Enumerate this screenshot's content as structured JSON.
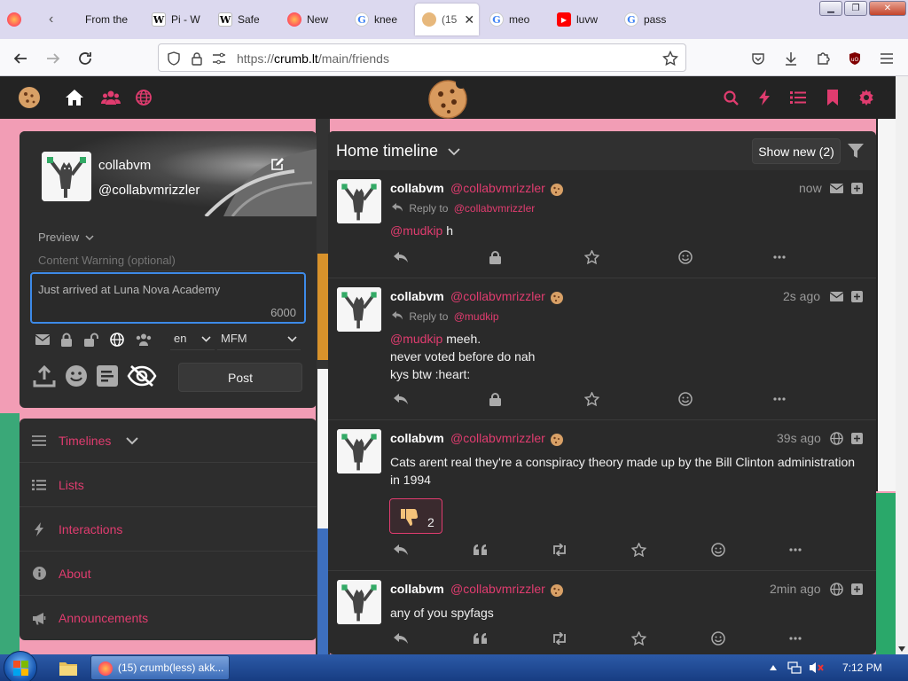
{
  "browser": {
    "tabs": [
      {
        "label": "",
        "icon": "firefox-icon"
      },
      {
        "label": "From the",
        "icon": "page-icon"
      },
      {
        "label": "Pi - W",
        "icon": "wikipedia-icon"
      },
      {
        "label": "Safe",
        "icon": "wikipedia-icon"
      },
      {
        "label": "New",
        "icon": "firefox-icon"
      },
      {
        "label": "knee",
        "icon": "google-icon"
      },
      {
        "label": "(15",
        "icon": "cookie-icon",
        "active": true
      },
      {
        "label": "meo",
        "icon": "google-icon"
      },
      {
        "label": "luvw",
        "icon": "youtube-icon"
      },
      {
        "label": "pass",
        "icon": "google-icon"
      }
    ],
    "url": "https://crumb.lt/main/friends",
    "url_scheme": "https://",
    "url_host": "crumb.lt",
    "url_path": "/main/friends"
  },
  "app": {
    "accent": "#e03c6f",
    "user": {
      "name": "collabvm",
      "handle": "@collabvmrizzler"
    },
    "post_form": {
      "preview_label": "Preview",
      "cw_placeholder": "Content Warning (optional)",
      "text_value": "Just arrived at Luna Nova Academy",
      "char_remaining": "6000",
      "language": "en",
      "format": "MFM",
      "post_label": "Post"
    },
    "nav": [
      {
        "label": "Timelines",
        "icon": "bars-icon"
      },
      {
        "label": "Lists",
        "icon": "list-icon"
      },
      {
        "label": "Interactions",
        "icon": "bolt-icon"
      },
      {
        "label": "About",
        "icon": "info-icon"
      },
      {
        "label": "Announcements",
        "icon": "megaphone-icon"
      }
    ]
  },
  "timeline": {
    "title": "Home timeline",
    "show_new": "Show new (2)",
    "statuses": [
      {
        "name": "collabvm",
        "handle": "@collabvmrizzler",
        "time": "now",
        "reply_label": "Reply to",
        "reply_to": "@collabvmrizzler",
        "mention": "@mudkip",
        "text": " h"
      },
      {
        "name": "collabvm",
        "handle": "@collabvmrizzler",
        "time": "2s ago",
        "reply_label": "Reply to",
        "reply_to": "@mudkip",
        "mention": "@mudkip",
        "text": " meeh.",
        "line2": "never voted before do nah",
        "line3": "kys btw :heart:"
      },
      {
        "name": "collabvm",
        "handle": "@collabvmrizzler",
        "time": "39s ago",
        "line1": "Cats arent real they're a conspiracy theory made up by the Bill Clinton administration",
        "line2": "in 1994",
        "reaction_count": "2"
      },
      {
        "name": "collabvm",
        "handle": "@collabvmrizzler",
        "time": "2min ago",
        "line1": "any of you spyfags"
      }
    ]
  },
  "taskbar": {
    "firefox_label": "(15) crumb(less) akk...",
    "clock": "7:12 PM"
  }
}
